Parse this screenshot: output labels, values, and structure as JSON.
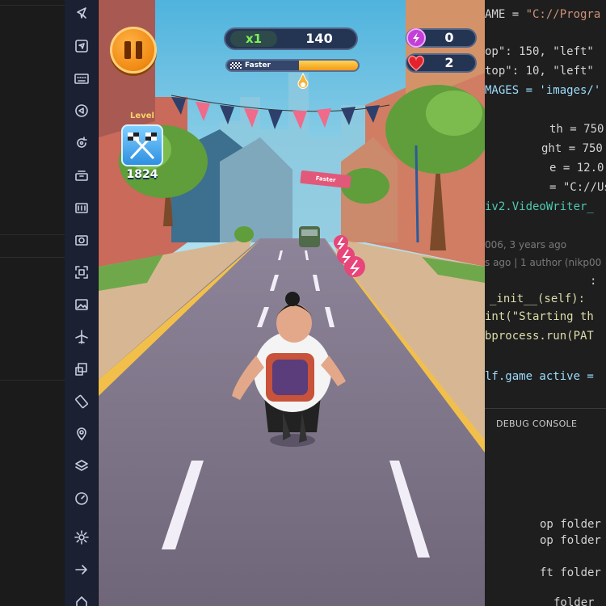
{
  "game": {
    "score": "140",
    "multiplier": "x1",
    "boost_label": "Faster",
    "boost_progress": 0.45,
    "coins": "0",
    "lives": "2",
    "level_label": "Level",
    "level_number": "1824",
    "banner_text": "Faster"
  },
  "emulator_sidebar": {
    "buttons": [
      "cursor-arrow-icon",
      "navigation-icon",
      "keyboard-icon",
      "back-play-icon",
      "rotate-icon",
      "apk-install-icon",
      "apk-icon",
      "camera-icon",
      "screenshot-icon",
      "gallery-icon",
      "airplane-icon",
      "multi-window-icon",
      "rotate-screen-icon",
      "location-icon",
      "layers-icon",
      "speedometer-icon",
      "settings-icon",
      "arrow-right-icon",
      "home-icon"
    ]
  },
  "editor": {
    "lines": [
      {
        "prefix": "AME = ",
        "str": "\"C://Progra"
      },
      {
        "prefix": "op\": 150, \"left\""
      },
      {
        "prefix": "top\": 10, \"left\""
      },
      {
        "prefix": "MAGES = 'images/'"
      },
      {
        "prefix": "th = 750"
      },
      {
        "prefix": "ght = 750"
      },
      {
        "prefix": "e = 12.0"
      },
      {
        "prefix": "= \"C://Users//"
      },
      {
        "prefix": "iv2.VideoWriter_"
      }
    ],
    "blame_line_1": "006, 3 years ago",
    "blame_line_2": "s ago | 1 author (nikp00",
    "code_lines_2": [
      ":",
      "_init__(self):",
      "int(\"Starting th",
      "bprocess.run(PAT",
      "lf.game active ="
    ],
    "panel_tab": "DEBUG CONSOLE",
    "terminal_lines": [
      "op folder",
      "op folder",
      "ft folder",
      "folder"
    ]
  },
  "colors": {
    "hud_bg": "#243554",
    "multiplier_green": "#7cf05a",
    "boost_yellow": "#f39b14",
    "pause_orange": "#f08a12"
  }
}
